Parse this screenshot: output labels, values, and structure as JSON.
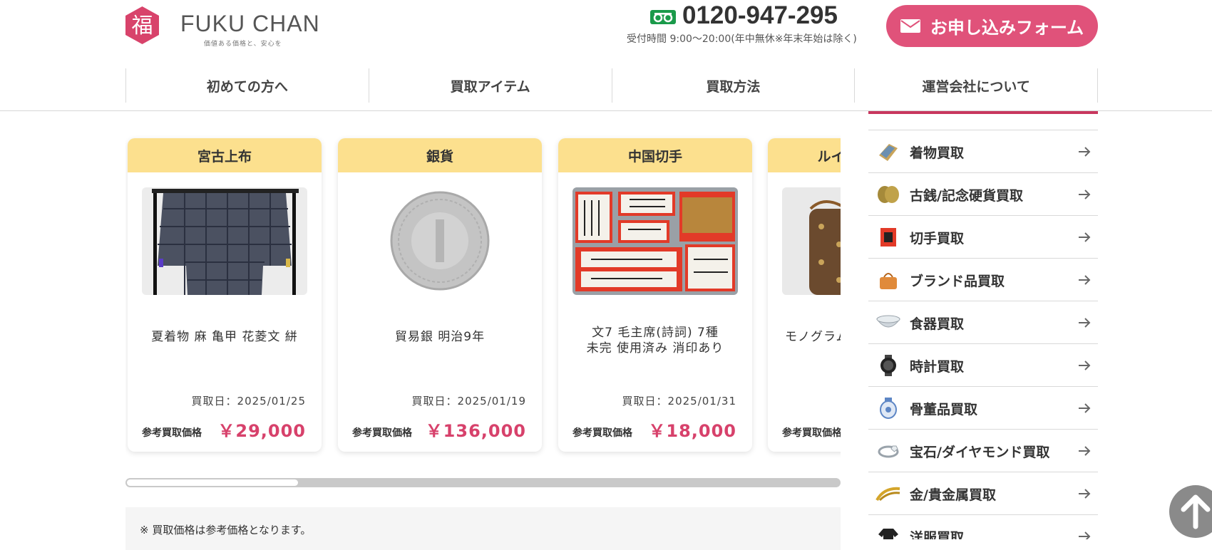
{
  "header": {
    "logo_mark_char": "福",
    "brand": "FUKU CHAN",
    "tagline": "価値ある価格と、安心を",
    "phone": "0120-947-295",
    "hours": "受付時間 9:00〜20:00(年中無休※年末年始は除く)",
    "form_button": "お申し込みフォーム",
    "icons": {
      "phone": "freedial-icon",
      "form": "mail-icon"
    },
    "colors": {
      "accent": "#e0527a",
      "logo": "#d8436b"
    }
  },
  "nav": {
    "items": [
      {
        "label": "初めての方へ"
      },
      {
        "label": "買取アイテム"
      },
      {
        "label": "買取方法"
      },
      {
        "label": "運営会社について"
      }
    ]
  },
  "cards": [
    {
      "category": "宮古上布",
      "name": "夏着物 麻 亀甲 花菱文 絣",
      "date": "買取日：2025/01/25",
      "price_label": "参考買取価格",
      "price": "￥29,000",
      "image": "kimono-image"
    },
    {
      "category": "銀貨",
      "name": "貿易銀 明治9年",
      "date": "買取日：2025/01/19",
      "price_label": "参考買取価格",
      "price": "￥136,000",
      "image": "silver-coin-image"
    },
    {
      "category": "中国切手",
      "name": "文7 毛主席(詩詞) 7種\n未完 使用済み 消印あり",
      "date": "買取日：2025/01/31",
      "price_label": "参考買取価格",
      "price": "￥18,000",
      "image": "stamps-image"
    },
    {
      "category": "ルイ・ヴィトン",
      "name": "モノグラム",
      "date": "",
      "price_label": "参考買取価格",
      "price": "",
      "image": "bag-image"
    }
  ],
  "carousel": {
    "scroll_position": 0.24
  },
  "note": "※ 買取価格は参考価格となります。",
  "sidebar": {
    "items": [
      {
        "label": "着物買取",
        "icon": "kimono-icon"
      },
      {
        "label": "古銭/記念硬貨買取",
        "icon": "coin-icon"
      },
      {
        "label": "切手買取",
        "icon": "stamp-icon"
      },
      {
        "label": "ブランド品買取",
        "icon": "handbag-icon"
      },
      {
        "label": "食器買取",
        "icon": "tableware-icon"
      },
      {
        "label": "時計買取",
        "icon": "watch-icon"
      },
      {
        "label": "骨董品買取",
        "icon": "vase-icon"
      },
      {
        "label": "宝石/ダイヤモンド買取",
        "icon": "ring-icon"
      },
      {
        "label": "金/貴金属買取",
        "icon": "gold-chain-icon"
      },
      {
        "label": "洋服買取",
        "icon": "clothing-icon"
      }
    ]
  },
  "colors": {
    "price": "#d7416b",
    "card_header": "#fce08e",
    "sidebar_accent": "#c8375e"
  }
}
